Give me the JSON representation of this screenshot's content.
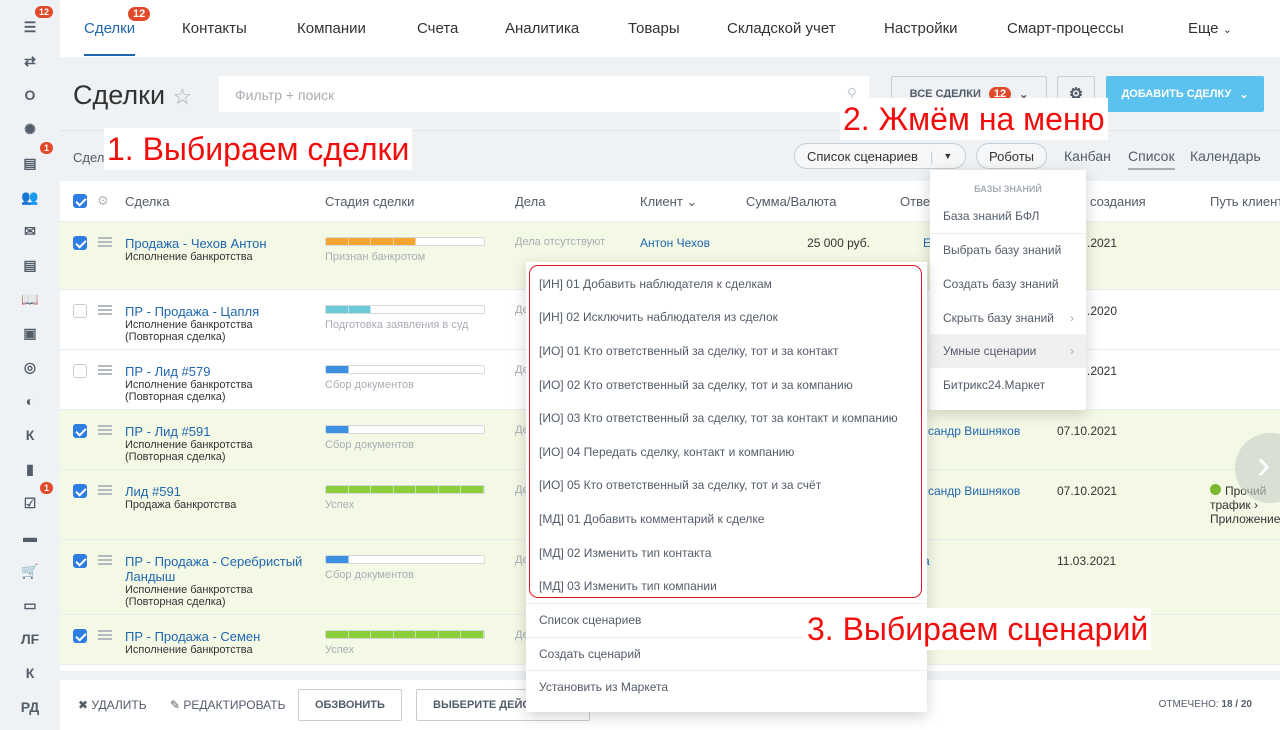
{
  "sidebar": {
    "items": [
      {
        "icon": "filter-icon",
        "badge": "12"
      },
      {
        "icon": "sync-icon"
      },
      {
        "text": "О"
      },
      {
        "icon": "sites-icon"
      },
      {
        "icon": "calendar-icon",
        "badge": "1"
      },
      {
        "icon": "people-icon"
      },
      {
        "icon": "mail-icon"
      },
      {
        "icon": "document-icon"
      },
      {
        "icon": "book-icon"
      },
      {
        "icon": "contact-card-icon"
      },
      {
        "icon": "target-icon"
      },
      {
        "icon": "moon-icon"
      },
      {
        "text": "К"
      },
      {
        "icon": "chart-icon"
      },
      {
        "icon": "task-icon",
        "badge": "1"
      },
      {
        "icon": "cash-register-icon"
      },
      {
        "icon": "cart-icon"
      },
      {
        "icon": "window-icon"
      },
      {
        "text": "ЛF"
      },
      {
        "text": "К"
      },
      {
        "text": "РД"
      }
    ]
  },
  "topnav": {
    "tabs": [
      "Сделки",
      "Контакты",
      "Компании",
      "Счета",
      "Аналитика",
      "Товары",
      "Складской учет",
      "Настройки",
      "Смарт-процессы",
      "Еще"
    ],
    "deals_badge": "12"
  },
  "header": {
    "title": "Сделки",
    "search_placeholder": "Фильтр + поиск",
    "all_deals": "ВСЕ СДЕЛКИ",
    "all_deals_count": "12",
    "add_deal": "ДОБАВИТЬ СДЕЛКУ"
  },
  "toolbar": {
    "left_label": "Сдел",
    "scenarios": "Список сценариев",
    "robots": "Роботы",
    "views": [
      "Канбан",
      "Список",
      "Календарь"
    ]
  },
  "table": {
    "columns": [
      "Сделка",
      "Стадия сделки",
      "Дела",
      "Клиент",
      "Сумма/Валюта",
      "Отве",
      "создания",
      "Путь клиент"
    ],
    "rows": [
      {
        "checked": true,
        "name": "Продажа - Чехов Антон",
        "sub": "Исполнение банкротства",
        "stage": "Признан банкротом",
        "progress": 4,
        "color": "#f2a531",
        "tasks": "Дела отсутствуют",
        "client": "Антон Чехов",
        "sum": "25 000 руб.",
        "resp": "Екате",
        "date": ".2021"
      },
      {
        "checked": false,
        "name": "ПР - Продажа - Цапля",
        "sub": "Исполнение банкротства (Повторная сделка)",
        "stage": "Подготовка заявления в суд",
        "progress": 2,
        "color": "#6cc7d7",
        "tasks": "Де",
        "date": ".2020"
      },
      {
        "checked": false,
        "name": "ПР - Лид #579",
        "sub": "Исполнение банкротства (Повторная сделка)",
        "stage": "Сбор документов",
        "progress": 1,
        "color": "#3d8fe0",
        "tasks": "Де",
        "date": ".2021"
      },
      {
        "checked": true,
        "name": "ПР - Лид #591",
        "sub": "Исполнение банкротства (Повторная сделка)",
        "stage": "Сбор документов",
        "progress": 1,
        "color": "#3d8fe0",
        "tasks": "Де",
        "resp": "сандр Вишняков",
        "date": "07.10.2021"
      },
      {
        "checked": true,
        "name": "Лид #591",
        "sub": "Продажа банкротства",
        "stage": "Успех",
        "progress": 7,
        "color": "#8bce3a",
        "tasks": "Де",
        "resp": "сандр Вишняков",
        "date": "07.10.2021",
        "route": [
          "Прочий",
          "трафик",
          "Приложение"
        ]
      },
      {
        "checked": true,
        "name": "ПР - Продажа - Серебристый Ландыш",
        "sub": "Исполнение банкротства (Повторная сделка)",
        "stage": "Сбор документов",
        "progress": 1,
        "color": "#3d8fe0",
        "tasks": "Де",
        "resp": "а",
        "date": "11.03.2021"
      },
      {
        "checked": true,
        "name": "ПР - Продажа - Семен",
        "sub": "Исполнение банкротства",
        "stage": "Успех",
        "progress": 7,
        "color": "#8bce3a",
        "tasks": "Де"
      }
    ]
  },
  "knowledge_menu": {
    "header": "БАЗЫ ЗНАНИЙ",
    "items": [
      "База знаний БФЛ",
      "Выбрать базу знаний",
      "Создать базу знаний",
      "Скрыть базу знаний",
      "Умные сценарии",
      "Битрикс24.Маркет"
    ]
  },
  "scenario_menu": {
    "items": [
      "[ИН] 01 Добавить наблюдателя к сделкам",
      "[ИН] 02 Исключить наблюдателя из сделок",
      "[ИО] 01 Кто ответственный за сделку, тот и за контакт",
      "[ИО] 02 Кто ответственный за сделку, тот и за компанию",
      "[ИО] 03 Кто ответственный за сделку, тот за контакт и компанию",
      "[ИО] 04 Передать сделку, контакт и компанию",
      "[ИО] 05 Кто ответственный за сделку, тот и за счёт",
      "[МД] 01 Добавить комментарий к сделке",
      "[МД] 02 Изменить тип контакта",
      "[МД] 03 Изменить тип компании"
    ],
    "footer": [
      "Список сценариев",
      "Создать сценарий",
      "Установить из Маркета"
    ]
  },
  "bottom": {
    "delete": "УДАЛИТЬ",
    "edit": "РЕДАКТИРОВАТЬ",
    "call": "ОБЗВОНИТЬ",
    "choose": "ВЫБЕРИТЕ ДЕЙСТ",
    "selected_label": "ОТМЕЧЕНО:",
    "selected": "18 / 20"
  },
  "annotations": [
    "1. Выбираем сделки",
    "2. Жмём на меню",
    "3. Выбираем сценарий"
  ]
}
